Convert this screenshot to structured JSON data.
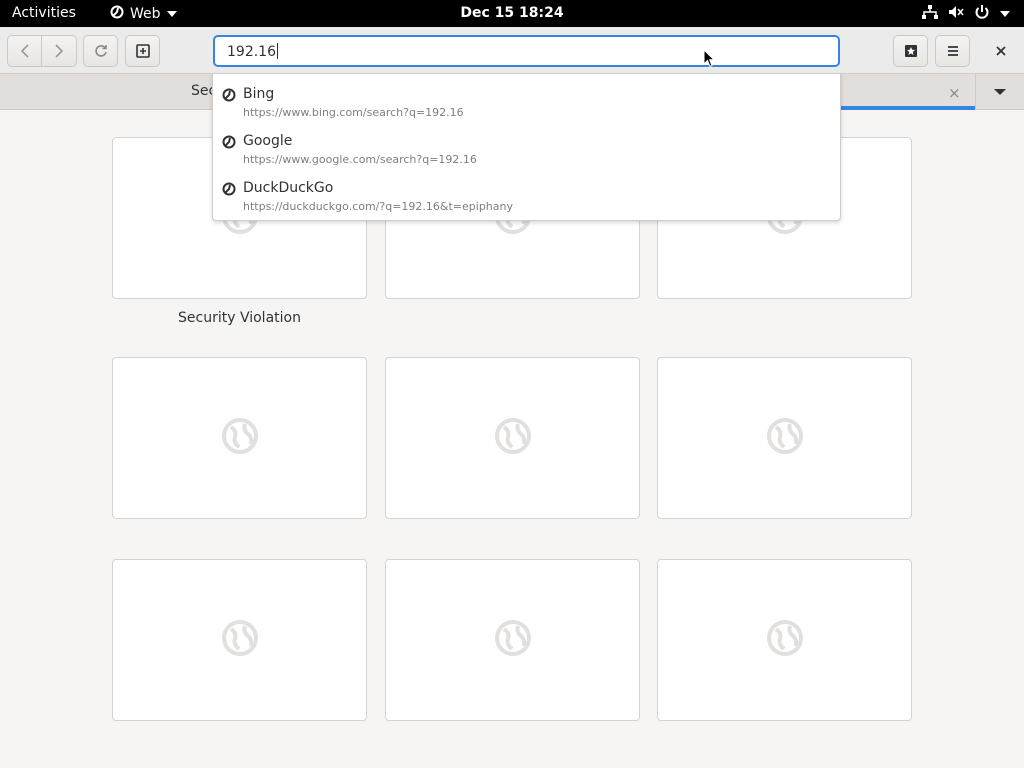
{
  "topbar": {
    "activities": "Activities",
    "app_name": "Web",
    "clock": "Dec 15  18:24"
  },
  "toolbar": {
    "url_value": "192.16"
  },
  "tabs": [
    {
      "title": "Sec"
    }
  ],
  "tab_close": "×",
  "suggestions": [
    {
      "name": "Bing",
      "url": "https://www.bing.com/search?q=192.16"
    },
    {
      "name": "Google",
      "url": "https://www.google.com/search?q=192.16"
    },
    {
      "name": "DuckDuckGo",
      "url": "https://duckduckgo.com/?q=192.16&t=epiphany"
    }
  ],
  "tiles": [
    {
      "label": "Security Violation"
    },
    {
      "label": ""
    },
    {
      "label": ""
    },
    {
      "label": ""
    },
    {
      "label": ""
    },
    {
      "label": ""
    },
    {
      "label": ""
    },
    {
      "label": ""
    },
    {
      "label": ""
    }
  ],
  "colors": {
    "accent": "#3584e4",
    "topbar_bg": "#000000",
    "window_bg": "#f6f5f4"
  },
  "icons": {
    "topbar_right": [
      "network-icon",
      "volume-muted-icon",
      "power-icon"
    ],
    "toolbar": [
      "back-icon",
      "forward-icon",
      "reload-icon",
      "new-tab-icon",
      "bookmarks-icon",
      "menu-icon",
      "close-icon"
    ],
    "suggestion": "epiphany-icon",
    "tile_placeholder": "globe-icon"
  }
}
